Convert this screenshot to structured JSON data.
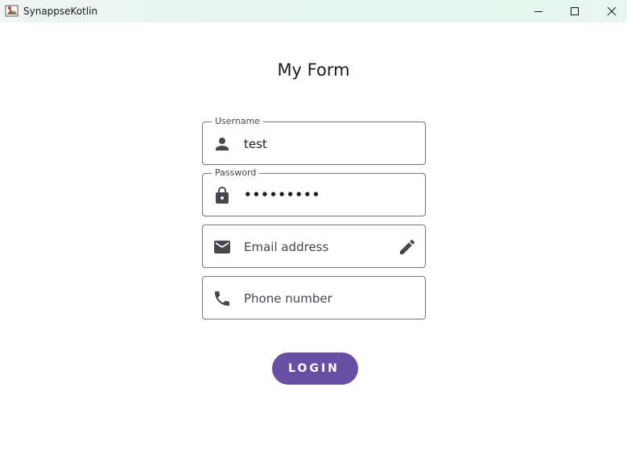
{
  "window": {
    "title": "SynappseKotlin"
  },
  "form": {
    "title": "My Form",
    "username": {
      "label": "Username",
      "value": "test",
      "icon": "person-icon"
    },
    "password": {
      "label": "Password",
      "value": "•••••••••",
      "icon": "lock-icon"
    },
    "email": {
      "placeholder": "Email address",
      "icon": "mail-icon",
      "trailing_icon": "edit-pencil-icon"
    },
    "phone": {
      "placeholder": "Phone number",
      "icon": "phone-icon"
    },
    "login_label": "LOGIN"
  },
  "colors": {
    "primary": "#6750a4",
    "outline": "#79747e",
    "icon": "#49454f"
  }
}
